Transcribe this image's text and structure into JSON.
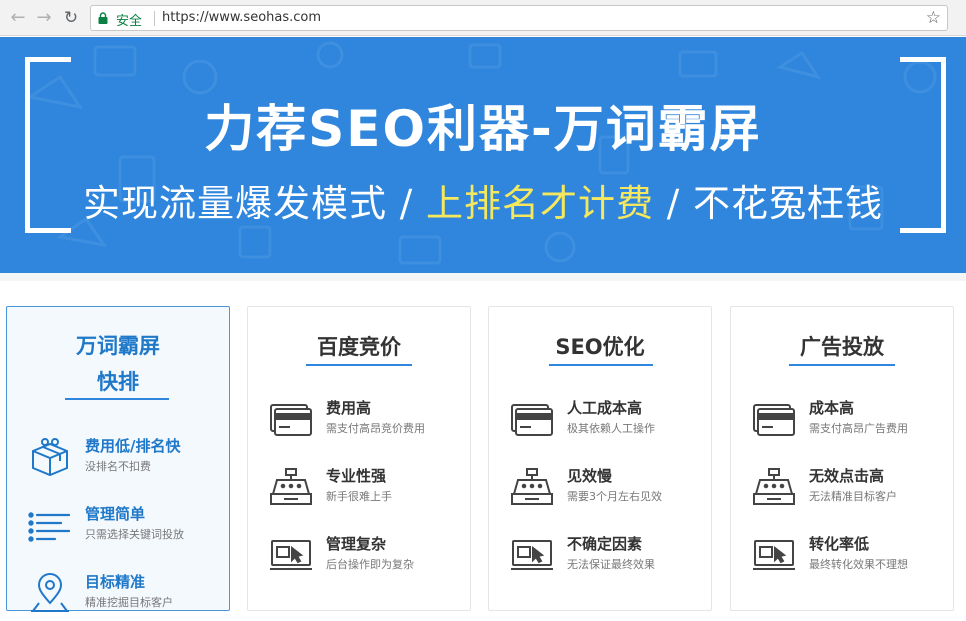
{
  "browser": {
    "secure_label": "安全",
    "url": "https://www.seohas.com"
  },
  "banner": {
    "headline": "力荐SEO利器-万词霸屏",
    "sub_part1": "实现流量爆发模式 / ",
    "sub_highlight": "上排名才计费",
    "sub_part2": " / 不花冤枉钱",
    "bg_color": "#2f86dc",
    "highlight_color": "#f6e85e"
  },
  "featured": {
    "title_line1": "万词霸屏",
    "title_line2": "快排",
    "items": [
      {
        "icon": "gift-icon",
        "title": "费用低/排名快",
        "desc": "没排名不扣费"
      },
      {
        "icon": "list-icon",
        "title": "管理简单",
        "desc": "只需选择关键词投放"
      },
      {
        "icon": "location-pin-icon",
        "title": "目标精准",
        "desc": "精准挖掘目标客户"
      }
    ]
  },
  "cards": [
    {
      "title": "百度竞价",
      "items": [
        {
          "icon": "credit-card-icon",
          "title": "费用高",
          "desc": "需支付高昂竞价费用"
        },
        {
          "icon": "cash-register-icon",
          "title": "专业性强",
          "desc": "新手很难上手"
        },
        {
          "icon": "screen-cursor-icon",
          "title": "管理复杂",
          "desc": "后台操作即为复杂"
        }
      ]
    },
    {
      "title": "SEO优化",
      "items": [
        {
          "icon": "credit-card-icon",
          "title": "人工成本高",
          "desc": "极其依赖人工操作"
        },
        {
          "icon": "cash-register-icon",
          "title": "见效慢",
          "desc": "需要3个月左右见效"
        },
        {
          "icon": "screen-cursor-icon",
          "title": "不确定因素",
          "desc": "无法保证最终效果"
        }
      ]
    },
    {
      "title": "广告投放",
      "items": [
        {
          "icon": "credit-card-icon",
          "title": "成本高",
          "desc": "需支付高昂广告费用"
        },
        {
          "icon": "cash-register-icon",
          "title": "无效点击高",
          "desc": "无法精准目标客户"
        },
        {
          "icon": "screen-cursor-icon",
          "title": "转化率低",
          "desc": "最终转化效果不理想"
        }
      ]
    }
  ]
}
